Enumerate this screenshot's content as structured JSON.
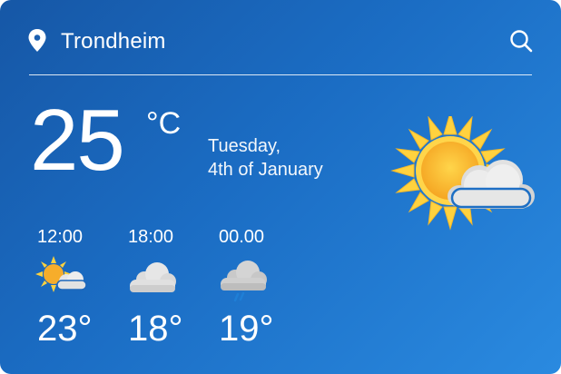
{
  "location": {
    "icon": "location-pin-icon",
    "city": "Trondheim"
  },
  "header": {
    "search_icon": "search-icon"
  },
  "current": {
    "temperature": "25",
    "unit": "°C",
    "day": "Tuesday,",
    "date": "4th of January",
    "condition_icon": "partly-sunny-icon"
  },
  "forecast": [
    {
      "time": "12:00",
      "temperature": "23°",
      "icon": "partly-sunny-icon"
    },
    {
      "time": "18:00",
      "temperature": "18°",
      "icon": "cloudy-icon"
    },
    {
      "time": "00.00",
      "temperature": "19°",
      "icon": "rain-cloud-icon"
    }
  ],
  "colors": {
    "card_gradient_start": "#1657a6",
    "card_gradient_end": "#2a8ae0",
    "sun": "#ffc533",
    "cloud": "#e4e4e4",
    "rain": "#2e86d8"
  }
}
